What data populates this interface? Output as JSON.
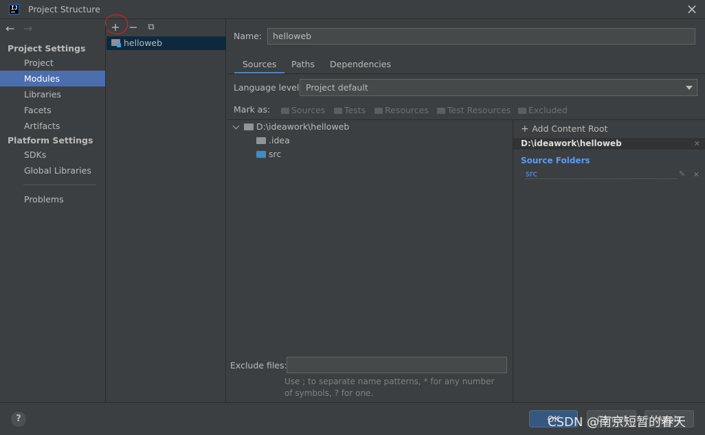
{
  "window": {
    "title": "Project Structure",
    "close_icon": "close-icon"
  },
  "nav": {
    "back_icon": "←",
    "forward_icon": "→",
    "project_settings_heading": "Project Settings",
    "project_settings_items": [
      "Project",
      "Modules",
      "Libraries",
      "Facets",
      "Artifacts"
    ],
    "platform_settings_heading": "Platform Settings",
    "platform_settings_items": [
      "SDKs",
      "Global Libraries"
    ],
    "problems": "Problems",
    "selected": "Modules"
  },
  "modules": {
    "toolbar": {
      "add": "+",
      "remove": "−",
      "copy": "⧉"
    },
    "items": [
      "helloweb"
    ]
  },
  "main": {
    "name_label": "Name:",
    "name_value": "helloweb",
    "tabs": [
      "Sources",
      "Paths",
      "Dependencies"
    ],
    "active_tab": "Sources",
    "language_level_label": "Language level:",
    "language_level_value": "Project default",
    "mark_as_label": "Mark as:",
    "mark_as_options": [
      "Sources",
      "Tests",
      "Resources",
      "Test Resources",
      "Excluded"
    ],
    "tree": {
      "root": "D:\\ideawork\\helloweb",
      "children": [
        ".idea",
        "src"
      ]
    },
    "content_root": {
      "add_label": "Add Content Root",
      "path": "D:\\ideawork\\helloweb",
      "source_folders_heading": "Source Folders",
      "source_folders": [
        "src"
      ]
    },
    "exclude_files_label": "Exclude files:",
    "exclude_files_value": "",
    "exclude_hint": "Use ; to separate name patterns, * for any number of symbols, ? for one."
  },
  "footer": {
    "help": "?",
    "ok": "OK",
    "cancel": "Cancel",
    "apply": "Apply",
    "watermark": "CSDN @南京短暂的春天"
  },
  "colors": {
    "accent": "#4b6eaf",
    "source_blue": "#589df6",
    "annotation_red": "#d02020"
  }
}
